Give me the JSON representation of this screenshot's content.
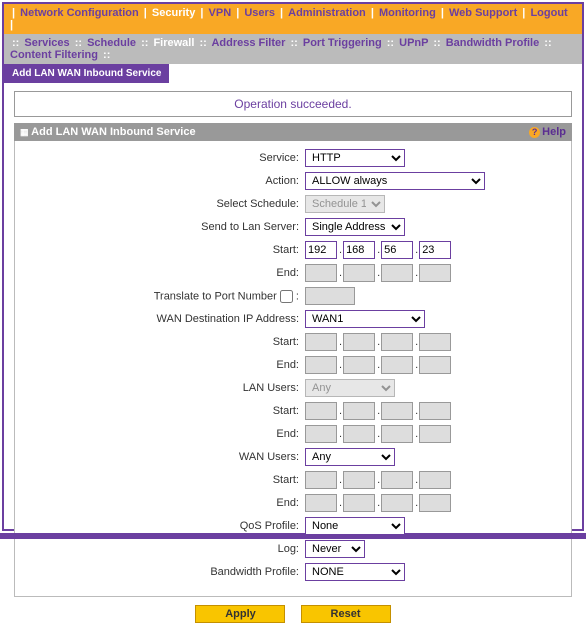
{
  "topnav": {
    "items": [
      "Network Configuration",
      "Security",
      "VPN",
      "Users",
      "Administration",
      "Monitoring",
      "Web Support",
      "Logout"
    ],
    "active": 1
  },
  "subnav": {
    "items": [
      "Services",
      "Schedule",
      "Firewall",
      "Address Filter",
      "Port Triggering",
      "UPnP",
      "Bandwidth Profile",
      "Content Filtering"
    ],
    "active": 2
  },
  "tab": "Add LAN WAN Inbound Service",
  "status": "Operation succeeded.",
  "section_title": "Add LAN WAN Inbound Service",
  "help": "Help",
  "labels": {
    "service": "Service:",
    "action": "Action:",
    "schedule": "Select Schedule:",
    "sendto": "Send to Lan Server:",
    "start": "Start:",
    "end": "End:",
    "translate": "Translate to Port Number",
    "wandest": "WAN Destination IP Address:",
    "lanusers": "LAN Users:",
    "wanusers": "WAN Users:",
    "qos": "QoS Profile:",
    "log": "Log:",
    "bw": "Bandwidth Profile:"
  },
  "values": {
    "service": "HTTP",
    "action": "ALLOW always",
    "schedule": "Schedule 1",
    "sendto": "Single Address",
    "start_ip": [
      "192",
      "168",
      "56",
      "23"
    ],
    "wandest": "WAN1",
    "lanusers": "Any",
    "wanusers": "Any",
    "qos": "None",
    "log": "Never",
    "bw": "NONE"
  },
  "buttons": {
    "apply": "Apply",
    "reset": "Reset"
  }
}
